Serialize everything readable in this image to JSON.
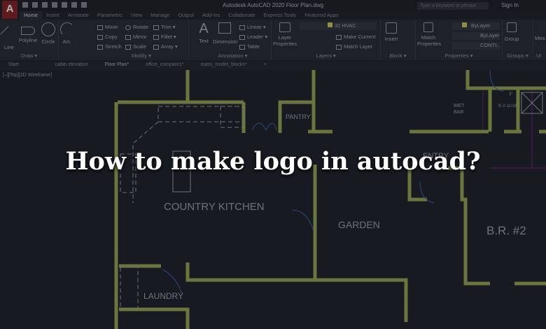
{
  "app": {
    "title": "Autodesk AutoCAD 2020   Floor Plan.dwg",
    "search_placeholder": "Type a keyword or phrase",
    "sign_in": "Sign In",
    "logo": "A"
  },
  "ribbon_tabs": [
    "Home",
    "Insert",
    "Annotate",
    "Parametric",
    "View",
    "Manage",
    "Output",
    "Add-ins",
    "Collaborate",
    "Express Tools",
    "Featured Apps"
  ],
  "panels": {
    "draw": {
      "title": "Draw ▾",
      "tools": [
        "Line",
        "Polyline",
        "Circle",
        "Arc"
      ]
    },
    "modify": {
      "title": "Modify ▾",
      "tools": [
        "Move",
        "Rotate",
        "Trim ▾",
        "Copy",
        "Mirror",
        "Fillet ▾",
        "Stretch",
        "Scale",
        "Array ▾"
      ]
    },
    "annotation": {
      "title": "Annotation ▾",
      "tools": [
        "Text",
        "Dimension",
        "Linear ▾",
        "Leader ▾",
        "Table"
      ]
    },
    "layers": {
      "title": "Layers ▾",
      "layer_properties": "Layer Properties",
      "current_layer": "32 HVAC",
      "make_current": "Make Current",
      "match_layer": "Match Layer"
    },
    "block": {
      "title": "Block ▾",
      "insert": "Insert"
    },
    "properties": {
      "title": "Properties ▾",
      "match_properties": "Match Properties",
      "color": "ByLayer",
      "linetype": "ByLayer",
      "lineweight": "CONTI..."
    },
    "groups": {
      "title": "Groups ▾",
      "group": "Group"
    },
    "utilities": {
      "title": "Ut",
      "measure": "Mea"
    }
  },
  "file_tabs": [
    "Start",
    "cabin elevation",
    "Floor Plan*",
    "office_compare1*",
    "mass_model_blocks*"
  ],
  "viewport_label": "[–][Top][2D Wireframe]",
  "rooms": {
    "kitchen": "COUNTRY KITCHEN",
    "pantry": "PANTRY",
    "garden": "GARDEN",
    "laundry": "LAUNDRY",
    "entry": "ENTRY",
    "br2": "B.R. #2",
    "wet": "WET",
    "bar": "BAR",
    "dim1": "9'-0 11/16\"",
    "dim2": "3\""
  },
  "headline": "How to make logo in autocad?",
  "colors": {
    "wall": "#8a9a4e",
    "canvas": "#1b1f27",
    "accent": "#7a1f24"
  }
}
